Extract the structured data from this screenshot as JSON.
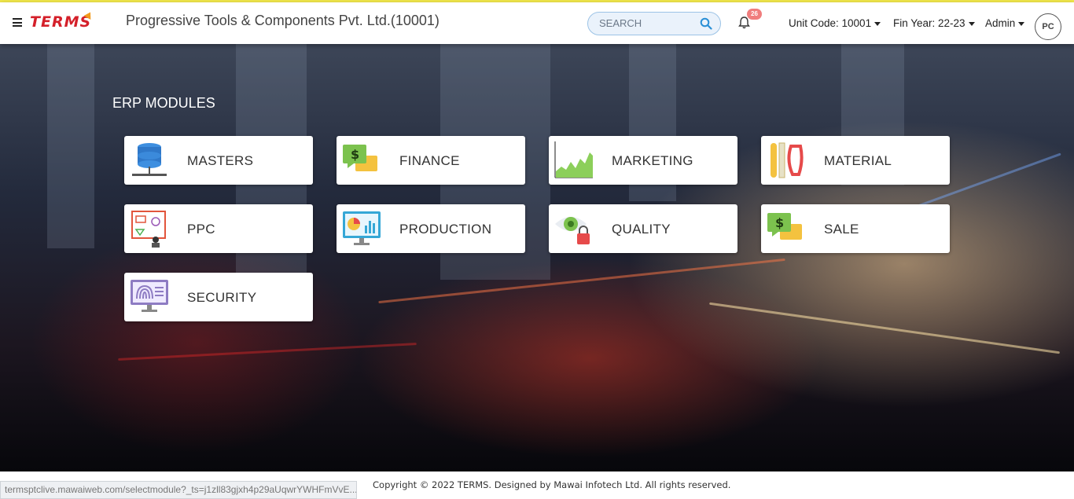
{
  "header": {
    "logo_text": "TERMS",
    "company": "Progressive Tools & Components Pvt. Ltd.(10001)",
    "search_placeholder": "SEARCH",
    "notification_count": "26",
    "unit_code": "Unit Code: 10001",
    "fin_year": "Fin Year: 22-23",
    "user": "Admin",
    "avatar_text": "PC"
  },
  "main": {
    "section_title": "ERP MODULES",
    "modules": [
      {
        "label": "MASTERS",
        "icon": "database-icon"
      },
      {
        "label": "FINANCE",
        "icon": "finance-chat-icon"
      },
      {
        "label": "MARKETING",
        "icon": "area-chart-icon"
      },
      {
        "label": "MATERIAL",
        "icon": "material-tools-icon"
      },
      {
        "label": "PPC",
        "icon": "planning-board-icon"
      },
      {
        "label": "PRODUCTION",
        "icon": "production-monitor-icon"
      },
      {
        "label": "QUALITY",
        "icon": "eye-lock-icon"
      },
      {
        "label": "SALE",
        "icon": "sale-chat-icon"
      },
      {
        "label": "SECURITY",
        "icon": "fingerprint-monitor-icon"
      }
    ]
  },
  "footer": {
    "copyright": "Copyright © 2022 TERMS. Designed by Mawai Infotech Ltd. All rights reserved."
  },
  "status_url": "termsptclive.mawaiweb.com/selectmodule?_ts=j1zll83gjxh4p29aUqwrYWHFmVvE..."
}
